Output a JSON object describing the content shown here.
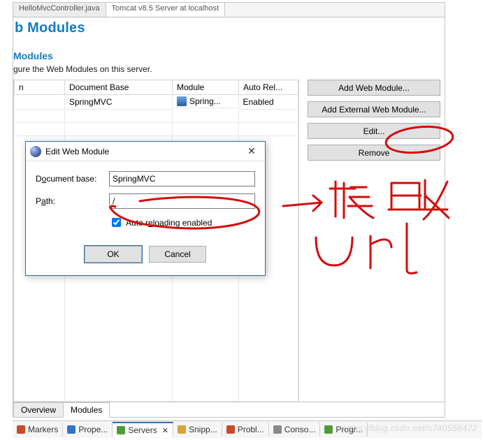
{
  "topTabs": {
    "left": "HelloMvcController.java",
    "right": "Tomcat v8.5 Server at localhost"
  },
  "page": {
    "title": "b Modules",
    "sectionTitle": "Modules",
    "sectionDesc": "gure the Web Modules on this server."
  },
  "table": {
    "cols": {
      "path": "n",
      "docbase": "Document Base",
      "module": "Module",
      "autorel": "Auto Rel..."
    },
    "row0": {
      "path": "",
      "docbase": "SpringMVC",
      "module": "Spring...",
      "autorel": "Enabled"
    }
  },
  "buttons": {
    "addWeb": "Add Web Module...",
    "addExternal": "Add External Web Module...",
    "edit": "Edit...",
    "remove": "Remove"
  },
  "bottomTabs": {
    "overview": "Overview",
    "modules": "Modules"
  },
  "dialog": {
    "title": "Edit Web Module",
    "docbaseLabel_pre": "D",
    "docbaseLabel_u": "o",
    "docbaseLabel_post": "cument base:",
    "docbaseValue": "SpringMVC",
    "pathLabel_pre": "P",
    "pathLabel_u": "a",
    "pathLabel_post": "th:",
    "pathValue": "/",
    "autoReload_pre": "Auto r",
    "autoReload_u": "e",
    "autoReload_post": "loading enabled",
    "ok": "OK",
    "cancel": "Cancel"
  },
  "views": {
    "markers": "Markers",
    "prope": "Prope...",
    "servers": "Servers",
    "snipp": "Snipp...",
    "probl": "Probl...",
    "conso": "Conso...",
    "progr": "Progr..."
  },
  "watermark": "https://blog.csdn.net/s740556472"
}
